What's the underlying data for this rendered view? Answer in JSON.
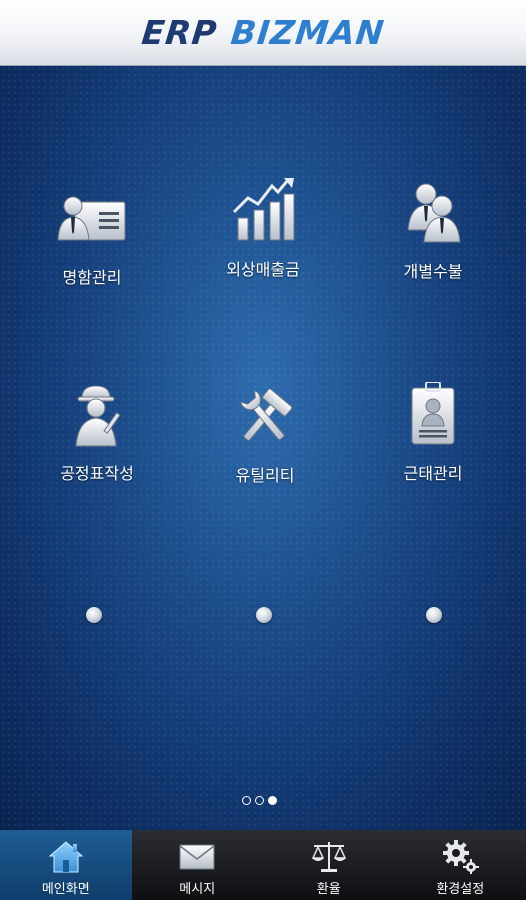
{
  "app": {
    "logo_part1": "ERP",
    "logo_part2": "BIZMAN"
  },
  "menu": [
    {
      "label": "명함관리",
      "icon": "business-card-icon"
    },
    {
      "label": "외상매출금",
      "icon": "growth-chart-icon"
    },
    {
      "label": "개별수불",
      "icon": "people-icon"
    },
    {
      "label": "공정표작성",
      "icon": "worker-icon"
    },
    {
      "label": "유틸리티",
      "icon": "tools-icon"
    },
    {
      "label": "근태관리",
      "icon": "id-badge-icon"
    }
  ],
  "pager": {
    "pages": 3,
    "current": 3
  },
  "tabs": [
    {
      "label": "메인화면",
      "icon": "home-icon",
      "active": true
    },
    {
      "label": "메시지",
      "icon": "envelope-icon",
      "active": false
    },
    {
      "label": "환율",
      "icon": "scale-icon",
      "active": false
    },
    {
      "label": "환경설정",
      "icon": "gear-icon",
      "active": false
    }
  ],
  "colors": {
    "background": "#1a4a88",
    "tab_active": "#1e5d93",
    "logo_dark": "#1e3a73",
    "logo_light": "#2f7fd0"
  }
}
